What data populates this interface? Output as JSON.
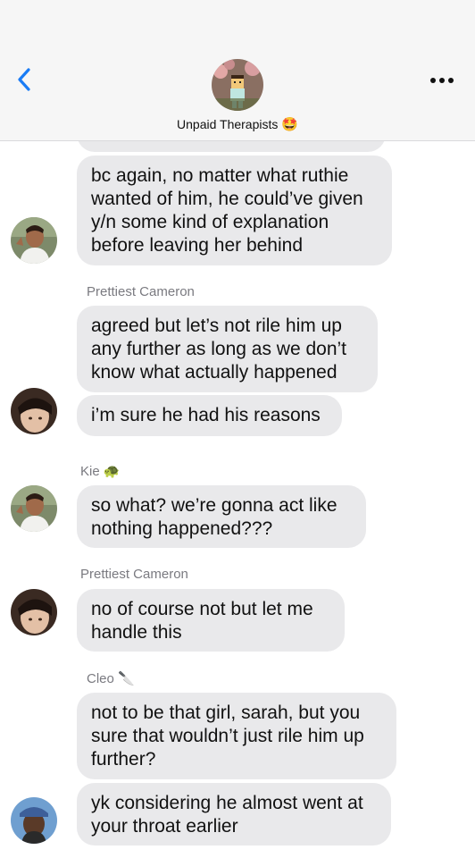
{
  "header": {
    "title": "Unpaid Therapists",
    "title_emoji": "🤩",
    "back_icon": "chevron-left-icon",
    "more_icon": "ellipsis-icon",
    "accent": "#1a7cf5"
  },
  "messages": [
    {
      "sender": "",
      "text": "bc again, no matter what ruthie wanted of him, he could’ve given y/n some kind of explanation before leaving her behind",
      "lines": [
        "bc again, no matter what ruthie",
        "wanted of him, he could’ve given",
        "y/n some kind of explanation",
        "before leaving her behind"
      ],
      "avatar": "kie"
    },
    {
      "sender": "Prettiest Cameron",
      "text": "agreed but let’s not rile him up any further as long as we don’t know what actually happened",
      "lines": [
        "agreed but let’s not rile him up",
        "any further as long as we don’t",
        "know what actually happened"
      ]
    },
    {
      "sender": "",
      "text": "i’m sure he had his reasons",
      "lines": [
        "i’m sure he had his reasons"
      ],
      "avatar": "cameron"
    },
    {
      "sender": "Kie",
      "sender_emoji": "🐢",
      "text": "so what? we’re gonna act like nothing happened???",
      "lines": [
        "so what? we’re gonna act like",
        "nothing happened???"
      ],
      "avatar": "kie"
    },
    {
      "sender": "Prettiest Cameron",
      "text": "no of course not but let me handle this",
      "lines": [
        "no of course not but let me",
        "handle this"
      ],
      "avatar": "cameron"
    },
    {
      "sender": "Cleo",
      "sender_emoji": "🔪",
      "text": "not to be that girl, sarah, but you sure that wouldn’t just rile him up further?",
      "lines": [
        "not to be that girl, sarah, but you",
        "sure that wouldn’t just rile him up",
        "further?"
      ]
    },
    {
      "sender": "",
      "text": "yk considering he almost went at your throat earlier",
      "lines": [
        "yk considering he almost went at",
        "your throat earlier"
      ],
      "avatar": "cleo"
    }
  ],
  "colors": {
    "bubble": "#e9e9eb",
    "sender_label": "#7a7a80",
    "header_bg": "#f6f6f6"
  }
}
